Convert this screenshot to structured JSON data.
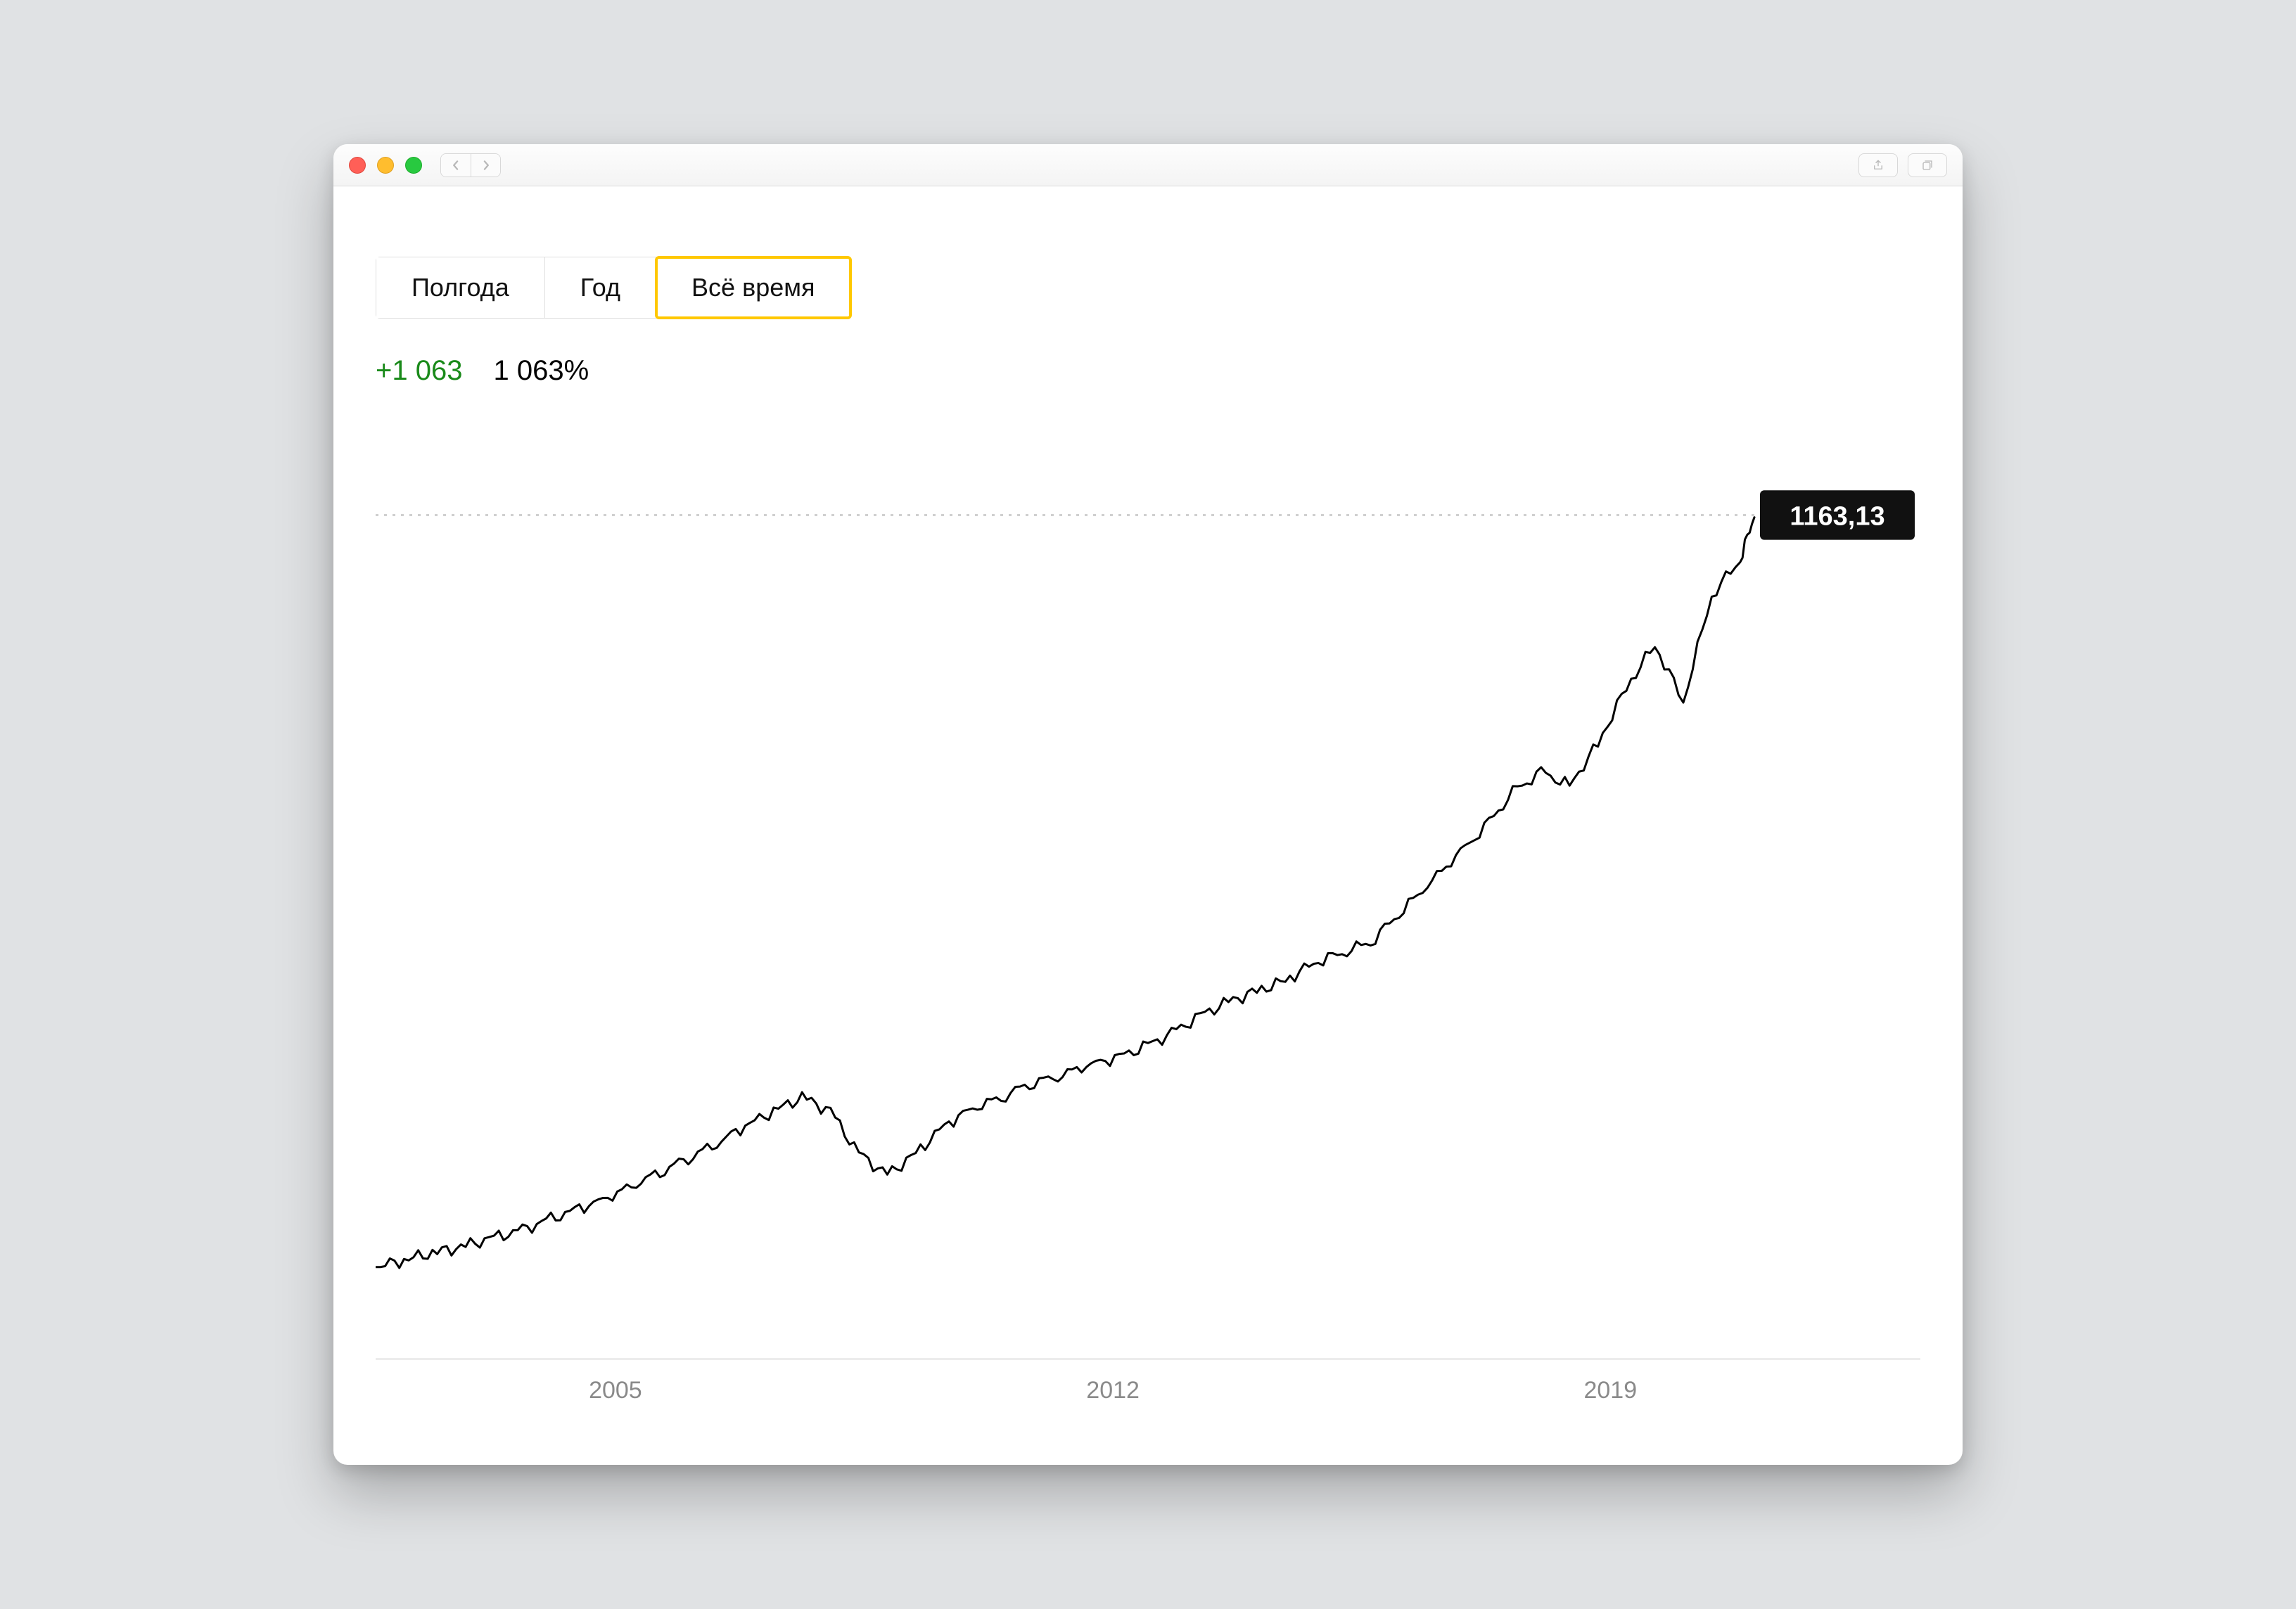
{
  "window": {
    "traffic_colors": {
      "close": "#ff5f57",
      "min": "#ffbd2e",
      "max": "#28c940"
    }
  },
  "tabs": {
    "items": [
      {
        "label": "Полгода",
        "active": false
      },
      {
        "label": "Год",
        "active": false
      },
      {
        "label": "Всё время",
        "active": true
      }
    ]
  },
  "stats": {
    "absolute": "+1 063",
    "percent": "1 063%",
    "accent_color": "#1a8a1a"
  },
  "badge": {
    "value": "1163,13"
  },
  "x_ticks": [
    "2005",
    "2012",
    "2019"
  ],
  "chart_data": {
    "type": "line",
    "title": "",
    "xlabel": "",
    "ylabel": "",
    "ylim": [
      0,
      1200
    ],
    "x": [
      2002.0,
      2002.4,
      2002.8,
      2003.2,
      2003.6,
      2004.0,
      2004.4,
      2004.8,
      2005.2,
      2005.6,
      2006.0,
      2006.4,
      2006.8,
      2007.2,
      2007.6,
      2008.0,
      2008.4,
      2008.8,
      2009.2,
      2009.6,
      2010.0,
      2010.4,
      2010.8,
      2011.2,
      2011.6,
      2012.0,
      2012.4,
      2012.8,
      2013.2,
      2013.6,
      2014.0,
      2014.4,
      2014.8,
      2015.2,
      2015.6,
      2016.0,
      2016.4,
      2016.8,
      2017.2,
      2017.6,
      2018.0,
      2018.4,
      2018.8,
      2019.2,
      2019.6,
      2020.0,
      2020.4,
      2020.8,
      2021.2,
      2021.4
    ],
    "values": [
      100,
      110,
      120,
      128,
      140,
      150,
      165,
      180,
      195,
      215,
      235,
      255,
      275,
      300,
      320,
      340,
      320,
      260,
      230,
      260,
      300,
      325,
      340,
      360,
      370,
      385,
      395,
      410,
      430,
      455,
      475,
      490,
      505,
      530,
      545,
      560,
      600,
      640,
      680,
      720,
      770,
      800,
      780,
      840,
      920,
      980,
      900,
      1050,
      1100,
      1163.13
    ],
    "series": [
      {
        "name": "index",
        "values": [
          100,
          110,
          120,
          128,
          140,
          150,
          165,
          180,
          195,
          215,
          235,
          255,
          275,
          300,
          320,
          340,
          320,
          260,
          230,
          260,
          300,
          325,
          340,
          360,
          370,
          385,
          395,
          410,
          430,
          455,
          475,
          490,
          505,
          530,
          545,
          560,
          600,
          640,
          680,
          720,
          770,
          800,
          780,
          840,
          920,
          980,
          900,
          1050,
          1100,
          1163.13
        ]
      }
    ],
    "reference_level": 1163.13,
    "x_tick_values": [
      2005,
      2012,
      2019
    ]
  }
}
